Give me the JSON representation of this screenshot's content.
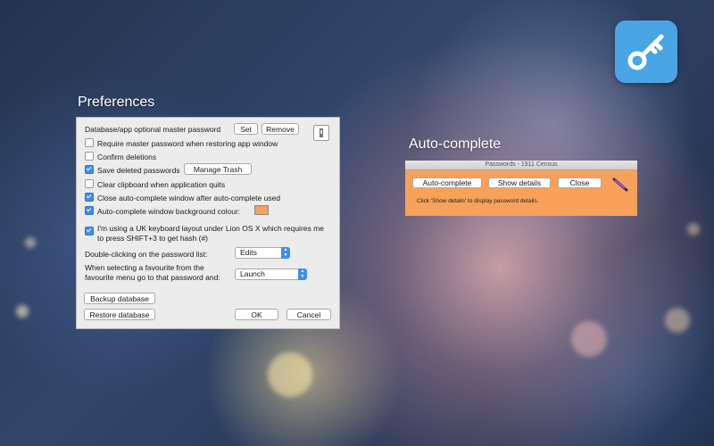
{
  "app": {
    "icon": "key-icon",
    "accent": "#4aa5e4"
  },
  "preferences": {
    "title": "Preferences",
    "master_password_label": "Database/app optional master password",
    "set_label": "Set",
    "remove_label": "Remove",
    "lock_icon": "lock-icon",
    "options": {
      "require_master": {
        "label": "Require master password when restoring app window",
        "checked": false
      },
      "confirm_deletions": {
        "label": "Confirm deletions",
        "checked": false
      },
      "save_deleted": {
        "label": "Save deleted passwords",
        "checked": true
      },
      "clear_clipboard": {
        "label": "Clear clipboard when application quits",
        "checked": false
      },
      "close_autocomplete": {
        "label": "Close auto-complete window after auto-complete used",
        "checked": true
      },
      "bg_colour": {
        "label": "Auto-complete window background colour:",
        "checked": true
      },
      "uk_keyboard": {
        "label_line1": "I'm using a UK keyboard layout under Lion OS X which requires me",
        "label_line2": "to press SHIFT+3 to get hash (#)",
        "checked": true
      }
    },
    "manage_trash_label": "Manage Trash",
    "bg_colour_value": "#f4a15a",
    "double_click_label": "Double-clicking on the password list:",
    "double_click_value": "Edits",
    "favourite_label_line1": "When selecting a favourite from the",
    "favourite_label_line2": "favourite menu go to that password and:",
    "favourite_value": "Launch",
    "backup_label": "Backup database",
    "restore_label": "Restore database",
    "ok_label": "OK",
    "cancel_label": "Cancel"
  },
  "autocomplete": {
    "title": "Auto-complete",
    "window_title": "Passwords - 1911 Census",
    "autocomplete_label": "Auto-complete",
    "show_details_label": "Show details",
    "close_label": "Close",
    "hint": "Click 'Show details' to display password details.",
    "background": "#f7a15a",
    "wand_icon": "magic-wand-icon"
  }
}
